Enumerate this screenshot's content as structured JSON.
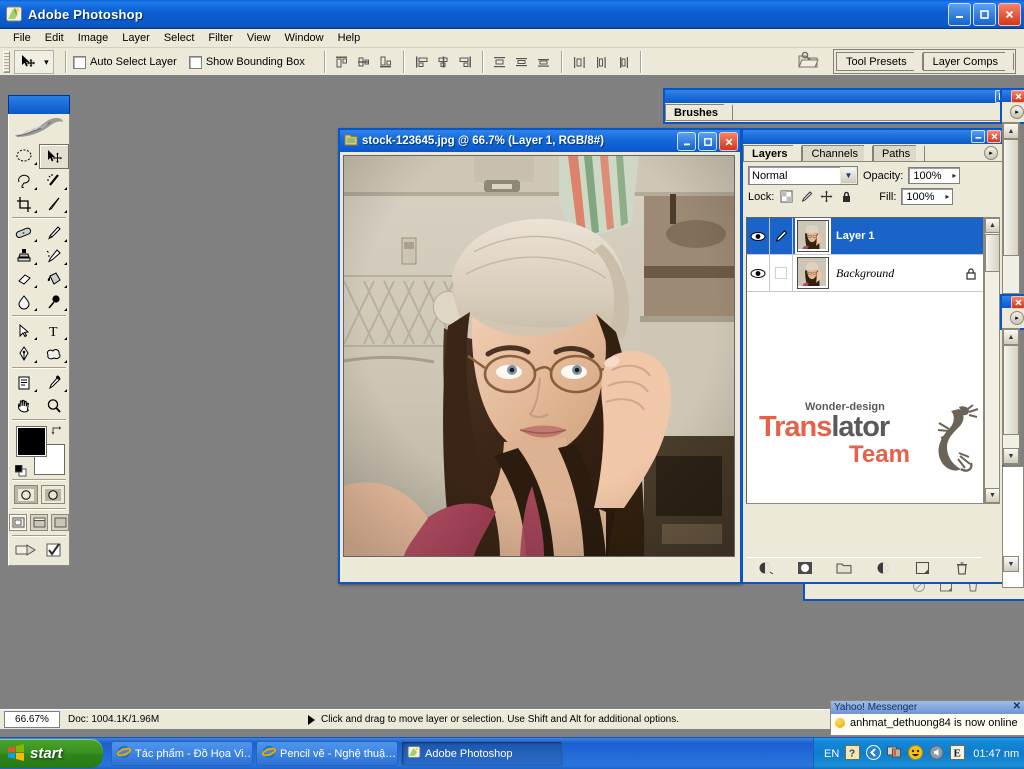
{
  "app": {
    "title": "Adobe Photoshop",
    "icon": "photoshop-icon",
    "window_buttons": {
      "minimize": "_",
      "maximize": "□",
      "close": "✕"
    },
    "menu": [
      "File",
      "Edit",
      "Image",
      "Layer",
      "Select",
      "Filter",
      "View",
      "Window",
      "Help"
    ]
  },
  "options_bar": {
    "tool": "move-tool",
    "tool_preset_caret": "▾",
    "auto_select_layer": {
      "label": "Auto Select Layer",
      "checked": false
    },
    "show_bounding_box": {
      "label": "Show Bounding Box",
      "checked": false
    },
    "align_icons": [
      "align-top-edges-icon",
      "align-vertical-centers-icon",
      "align-bottom-edges-icon",
      "align-left-edges-icon",
      "align-horizontal-centers-icon",
      "align-right-edges-icon"
    ],
    "distribute_icons": [
      "distribute-top-edges-icon",
      "distribute-vertical-centers-icon",
      "distribute-bottom-edges-icon",
      "distribute-left-edges-icon",
      "distribute-horizontal-centers-icon",
      "distribute-right-edges-icon"
    ],
    "file_browser_icon": "file-browser-icon",
    "palette_well": [
      "Tool Presets",
      "Layer Comps"
    ]
  },
  "toolbox": {
    "title_icon": "feather-logo",
    "tools": [
      {
        "name": "marquee-tool",
        "glyph": "ellipse-marquee",
        "selected": false
      },
      {
        "name": "move-tool",
        "glyph": "move-arrow",
        "selected": true
      },
      {
        "name": "lasso-tool",
        "glyph": "lasso",
        "selected": false
      },
      {
        "name": "magic-wand-tool",
        "glyph": "magic-wand",
        "selected": false
      },
      {
        "name": "crop-tool",
        "glyph": "crop",
        "selected": false
      },
      {
        "name": "slice-tool",
        "glyph": "slice-knife",
        "selected": false
      },
      {
        "name": "healing-brush-tool",
        "glyph": "bandage",
        "selected": false
      },
      {
        "name": "brush-tool",
        "glyph": "paintbrush",
        "selected": false
      },
      {
        "name": "clone-stamp-tool",
        "glyph": "rubber-stamp",
        "selected": false
      },
      {
        "name": "history-brush-tool",
        "glyph": "history-brush",
        "selected": false
      },
      {
        "name": "eraser-tool",
        "glyph": "eraser",
        "selected": false
      },
      {
        "name": "gradient-tool",
        "glyph": "paint-bucket",
        "selected": false
      },
      {
        "name": "blur-tool",
        "glyph": "waterdrop",
        "selected": false
      },
      {
        "name": "dodge-tool",
        "glyph": "dodge-lollipop",
        "selected": false
      },
      {
        "name": "path-selection-tool",
        "glyph": "path-arrow",
        "selected": false
      },
      {
        "name": "type-tool",
        "glyph": "letter-T",
        "selected": false
      },
      {
        "name": "pen-tool",
        "glyph": "pen-nib",
        "selected": false
      },
      {
        "name": "custom-shape-tool",
        "glyph": "shape-blob",
        "selected": false
      },
      {
        "name": "notes-tool",
        "glyph": "note-page",
        "selected": false
      },
      {
        "name": "eyedropper-tool",
        "glyph": "eyedropper",
        "selected": false
      },
      {
        "name": "hand-tool",
        "glyph": "hand",
        "selected": false
      },
      {
        "name": "zoom-tool",
        "glyph": "magnifier",
        "selected": false
      }
    ],
    "colors": {
      "foreground": "#000000",
      "background": "#ffffff"
    },
    "swap_icon": "swap-colors-icon",
    "default_icon": "default-colors-icon",
    "mask_modes": [
      "standard-mask-mode",
      "quick-mask-mode"
    ],
    "screen_modes": [
      "standard-screen-mode",
      "full-screen-with-menu-mode",
      "full-screen-mode"
    ],
    "jump_to": [
      "jump-to-imageready-icon",
      "jump-to-check-icon"
    ]
  },
  "document": {
    "title": "stock-123645.jpg @ 66.7% (Layer 1, RGB/8#)",
    "icon": "document-icon",
    "buttons": {
      "minimize": "_",
      "maximize": "□",
      "close": "✕"
    },
    "image_alt": "Photo of a woman wearing glasses and a light cloth hat resting her chin on her hand in a kitchen"
  },
  "brushes_palette": {
    "tab": "Brushes",
    "buttons": {
      "maximize": "□",
      "close": "✕"
    },
    "menu_arrow": "▸"
  },
  "layers_palette": {
    "buttons": {
      "minimize": "_",
      "close": "✕"
    },
    "tabs": [
      {
        "label": "Layers",
        "active": true
      },
      {
        "label": "Channels",
        "active": false
      },
      {
        "label": "Paths",
        "active": false
      }
    ],
    "menu_arrow": "▸",
    "blend_mode": "Normal",
    "opacity_label": "Opacity:",
    "opacity_value": "100%",
    "lock_label": "Lock:",
    "lock_icons": [
      "lock-transparent-pixels-icon",
      "lock-image-pixels-icon",
      "lock-position-icon",
      "lock-all-icon"
    ],
    "fill_label": "Fill:",
    "fill_value": "100%",
    "layers": [
      {
        "name": "Layer 1",
        "selected": true,
        "visible": true,
        "brush_marker": true,
        "locked": false,
        "italic": false
      },
      {
        "name": "Background",
        "selected": false,
        "visible": true,
        "brush_marker": false,
        "locked": true,
        "italic": true
      }
    ],
    "footer_icons": [
      "layer-style-icon",
      "layer-mask-icon",
      "new-group-icon",
      "new-adjustment-layer-icon",
      "new-layer-icon",
      "delete-layer-icon"
    ],
    "watermark": {
      "top": "Wonder-design",
      "main_dark": "Trans",
      "main_red": "lator",
      "sub": "Team",
      "mark_icon": "gecko-icon",
      "color_red": "#e8604a",
      "color_dark": "#5a5a5a"
    }
  },
  "status_bar": {
    "zoom": "66.67%",
    "doc": "Doc: 1004.1K/1.96M",
    "arrow": "▶",
    "hint": "Click and drag to move layer or selection.  Use Shift and Alt for additional options."
  },
  "taskbar": {
    "start_label": "start",
    "start_icon": "windows-flag-icon",
    "tasks": [
      {
        "label": "Tác phẩm - Đồ Họa Vi…",
        "icon": "internet-explorer-icon",
        "active": false
      },
      {
        "label": "Pencil vẽ - Nghệ thuậ…",
        "icon": "internet-explorer-icon",
        "active": false
      },
      {
        "label": "Adobe Photoshop",
        "icon": "photoshop-icon",
        "active": true
      }
    ],
    "tray": {
      "language": "EN",
      "icons": [
        "help-icon",
        "show-hidden-icons-icon",
        "network-icon",
        "yahoo-messenger-icon",
        "volume-icon",
        "ime-icon"
      ],
      "clock": "01:47 nm"
    }
  },
  "yahoo_toast": {
    "title": "Yahoo! Messenger",
    "close": "✕",
    "message": "anhmat_dethuong84 is now online",
    "status_icon": "online-status-icon"
  }
}
